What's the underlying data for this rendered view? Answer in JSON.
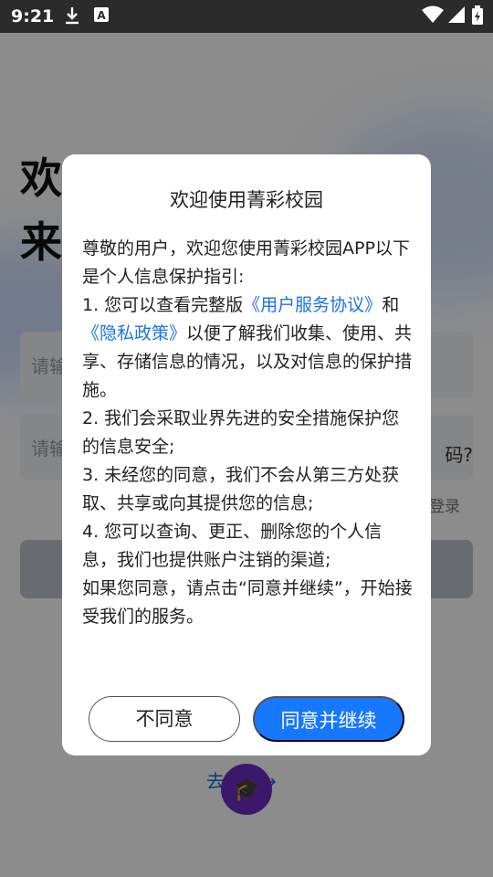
{
  "status_bar": {
    "time": "9:21",
    "icons": [
      "download-icon",
      "text-notification-icon",
      "wifi-icon",
      "signal-icon",
      "battery-icon"
    ]
  },
  "background": {
    "welcome_line1": "欢迎",
    "welcome_line2": "来",
    "account_placeholder": "请输",
    "password_placeholder": "请输",
    "forgot_password": "码?",
    "code_login": "登录",
    "register_link": "去注册→"
  },
  "dialog": {
    "title": "欢迎使用菁彩校园",
    "greeting": "尊敬的用户，欢迎您使用菁彩校园APP以下是个人信息保护指引:",
    "item1_prefix": "1. 您可以查看完整版",
    "user_agreement": "《用户服务协议》",
    "item1_and": "和",
    "privacy_policy": "《隐私政策》",
    "item1_suffix": "以便了解我们收集、使用、共享、存储信息的情况，以及对信息的保护措施。",
    "item2": "2. 我们会采取业界先进的安全措施保护您的信息安全;",
    "item3": "3. 未经您的同意，我们不会从第三方处获取、共享或向其提供您的信息;",
    "item4": "4. 您可以查询、更正、删除您的个人信息，我们也提供账户注销的渠道;",
    "closing": "如果您同意，请点击“同意并继续”，开始接受我们的服务。",
    "disagree_label": "不同意",
    "agree_label": "同意并继续"
  },
  "colors": {
    "accent": "#1677ff",
    "link": "#1a73e8",
    "overlay": "rgba(0,0,0,0.45)"
  }
}
